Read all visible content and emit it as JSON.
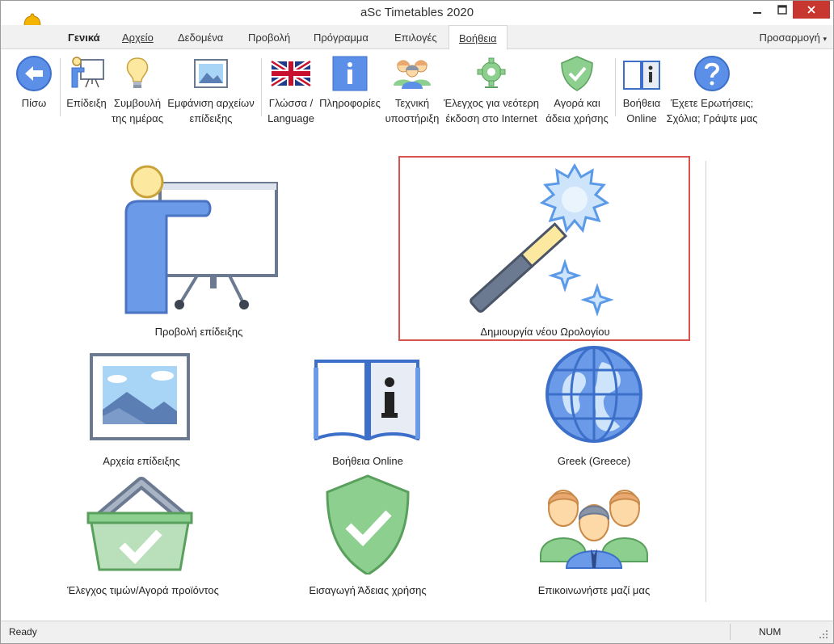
{
  "window": {
    "title": "aSc Timetables 2020",
    "app_icon": "bell-icon",
    "controls": [
      "minimize-icon",
      "maximize-icon",
      "close-icon"
    ],
    "close_color": "#c7372f"
  },
  "menu": {
    "tabs": [
      {
        "label": "Γενικά"
      },
      {
        "label": "Αρχείο"
      },
      {
        "label": "Δεδομένα"
      },
      {
        "label": "Προβολή"
      },
      {
        "label": "Πρόγραμμα"
      },
      {
        "label": "Επιλογές"
      },
      {
        "label": "Βοήθεια"
      }
    ],
    "active_tab": "Βοήθεια",
    "customize": "Προσαρμογή"
  },
  "ribbon": {
    "buttons": [
      {
        "line1": "Πίσω",
        "line2": "",
        "icon": "back-arrow-icon"
      },
      {
        "line1": "Επίδειξη",
        "line2": "",
        "icon": "presentation-icon"
      },
      {
        "line1": "Συμβουλή",
        "line2": "της ημέρας",
        "icon": "lightbulb-icon"
      },
      {
        "line1": "Εμφάνιση αρχείων",
        "line2": "επίδειξης",
        "icon": "picture-icon"
      },
      {
        "line1": "Γλώσσα /",
        "line2": "Language",
        "icon": "uk-flag-icon"
      },
      {
        "line1": "Πληροφορίες",
        "line2": "",
        "icon": "info-icon"
      },
      {
        "line1": "Τεχνική",
        "line2": "υποστήριξη",
        "icon": "support-team-icon"
      },
      {
        "line1": "Έλεγχος για νεότερη",
        "line2": "έκδοση στο Internet",
        "icon": "gear-update-icon"
      },
      {
        "line1": "Αγορά και",
        "line2": "άδεια χρήσης",
        "icon": "shield-check-icon"
      },
      {
        "line1": "Βοήθεια",
        "line2": "Online",
        "icon": "book-info-icon"
      },
      {
        "line1": "Έχετε Ερωτήσεις;",
        "line2": "Σχόλια; Γράψτε μας",
        "icon": "question-icon"
      }
    ]
  },
  "tiles": [
    {
      "label": "Προβολή επίδειξης",
      "icon": "presentation-icon"
    },
    {
      "label": "Δημιουργία νέου Ωρολογίου",
      "icon": "magic-wand-icon",
      "highlighted": true
    },
    {
      "label": "Αρχεία επίδειξης",
      "icon": "picture-icon"
    },
    {
      "label": "Βοήθεια Online",
      "icon": "book-info-icon"
    },
    {
      "label": "Greek (Greece)",
      "icon": "globe-icon"
    },
    {
      "label": "Έλεγχος τιμών/Αγορά προϊόντος",
      "icon": "basket-check-icon"
    },
    {
      "label": "Εισαγωγή Άδειας χρήσης",
      "icon": "shield-check-icon"
    },
    {
      "label": "Επικοινωνήστε μαζί μας",
      "icon": "contact-people-icon"
    }
  ],
  "colors": {
    "accent_blue": "#5b8fe8",
    "highlight_border": "#d9534f",
    "check_green": "#6fbf73"
  },
  "status": {
    "left": "Ready",
    "right": "NUM"
  }
}
